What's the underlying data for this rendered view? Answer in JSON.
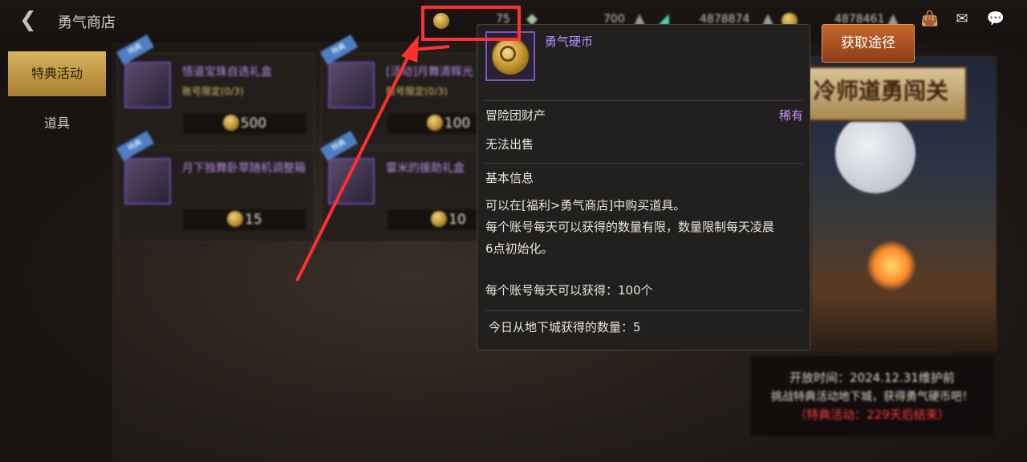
{
  "header": {
    "title": "勇气商店",
    "currency_1": "75",
    "currency_2": "700",
    "currency_3": "4878874",
    "currency_4": "4878461"
  },
  "sidebar": {
    "items": [
      {
        "label": "特典活动"
      },
      {
        "label": "道具"
      }
    ]
  },
  "shop": {
    "cards": [
      {
        "name": "悟道宝珠自选礼盒",
        "limit": "账号限定(0/3)",
        "price": "500",
        "ribbon": "特典"
      },
      {
        "name": "[活动]月舞清辉光",
        "limit": "账号限定(0/3)",
        "price": "100",
        "ribbon": "特典"
      },
      {
        "name": "月下独舞卧草随机调整箱",
        "limit": "",
        "price": "15",
        "ribbon": "特典"
      },
      {
        "name": "雷米的援助礼盒",
        "limit": "",
        "price": "10",
        "ribbon": "特典"
      }
    ]
  },
  "get_button": {
    "label": "获取途径"
  },
  "banner": {
    "title": "冷师道勇闯关",
    "open_time": "开放时间：2024.12.31维护前",
    "desc": "挑战特典活动地下城，获得勇气硬币吧！",
    "countdown": "（特典活动：229天后结束）"
  },
  "tooltip": {
    "item_name": "勇气硬币",
    "property": "冒险团财产",
    "rarity": "稀有",
    "trade": "无法出售",
    "section_basic": "基本信息",
    "line1": "可以在[福利>勇气商店]中购买道具。",
    "line2": "每个账号每天可以获得的数量有限，数量限制每天凌晨",
    "line3": "6点初始化。",
    "daily_limit": "每个账号每天可以获得：100个",
    "today_from_dungeon": "今日从地下城获得的数量：5"
  },
  "colors": {
    "accent_purple": "#b98bff",
    "highlight_red": "#ff3030",
    "countdown_red": "#ff3b3b",
    "button_orange": "#c7652c"
  },
  "icons": [
    "back-arrow-icon",
    "coin-icon",
    "gem-icon",
    "bag-icon",
    "mail-icon",
    "chat-icon"
  ]
}
